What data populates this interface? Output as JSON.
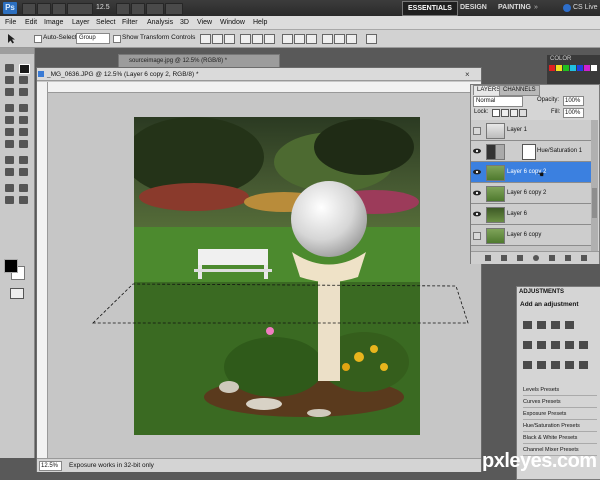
{
  "app": {
    "logo": "Ps",
    "zoom_level": "12.5",
    "workspaces": [
      "ESSENTIALS",
      "DESIGN",
      "PAINTING"
    ],
    "cs_live": "CS Live"
  },
  "menu": [
    "File",
    "Edit",
    "Image",
    "Layer",
    "Select",
    "Filter",
    "Analysis",
    "3D",
    "View",
    "Window",
    "Help"
  ],
  "options": {
    "auto_select_label": "Auto-Select:",
    "auto_select_value": "Group",
    "show_transform_label": "Show Transform Controls"
  },
  "document": {
    "back_tab_title": "sourceimage.jpg @ 12.5% (RGB/8) *",
    "title": "_MG_0636.JPG @ 12.5% (Layer 6 copy 2, RGB/8) *",
    "zoom": "12.5%",
    "status": "Exposure works in 32-bit only"
  },
  "color_panel": {
    "label": "COLOR"
  },
  "layers_panel": {
    "tab_layers": "LAYERS",
    "tab_channels": "CHANNELS",
    "blend_mode": "Normal",
    "opacity_label": "Opacity:",
    "opacity_value": "100%",
    "lock_label": "Lock:",
    "fill_label": "Fill:",
    "fill_value": "100%",
    "layers": [
      {
        "name": "Layer 1",
        "visible": false,
        "selected": false
      },
      {
        "name": "Hue/Saturation 1",
        "visible": true,
        "selected": false
      },
      {
        "name": "Layer 6 copy 2",
        "visible": true,
        "selected": true
      },
      {
        "name": "Layer 6 copy 2",
        "visible": true,
        "selected": false
      },
      {
        "name": "Layer 6",
        "visible": true,
        "selected": false
      },
      {
        "name": "Layer 6 copy",
        "visible": false,
        "selected": false
      }
    ]
  },
  "adjustments_panel": {
    "tab": "ADJUSTMENTS",
    "subtitle": "Add an adjustment",
    "presets": [
      "Levels Presets",
      "Curves Presets",
      "Exposure Presets",
      "Hue/Saturation Presets",
      "Black & White Presets",
      "Channel Mixer Presets"
    ]
  },
  "watermark": "pxleyes.com",
  "colors": {
    "selected_layer": "#3b80e0",
    "app_bar": "#2f2f2f",
    "canvas_bg": "#c6c6c6"
  }
}
